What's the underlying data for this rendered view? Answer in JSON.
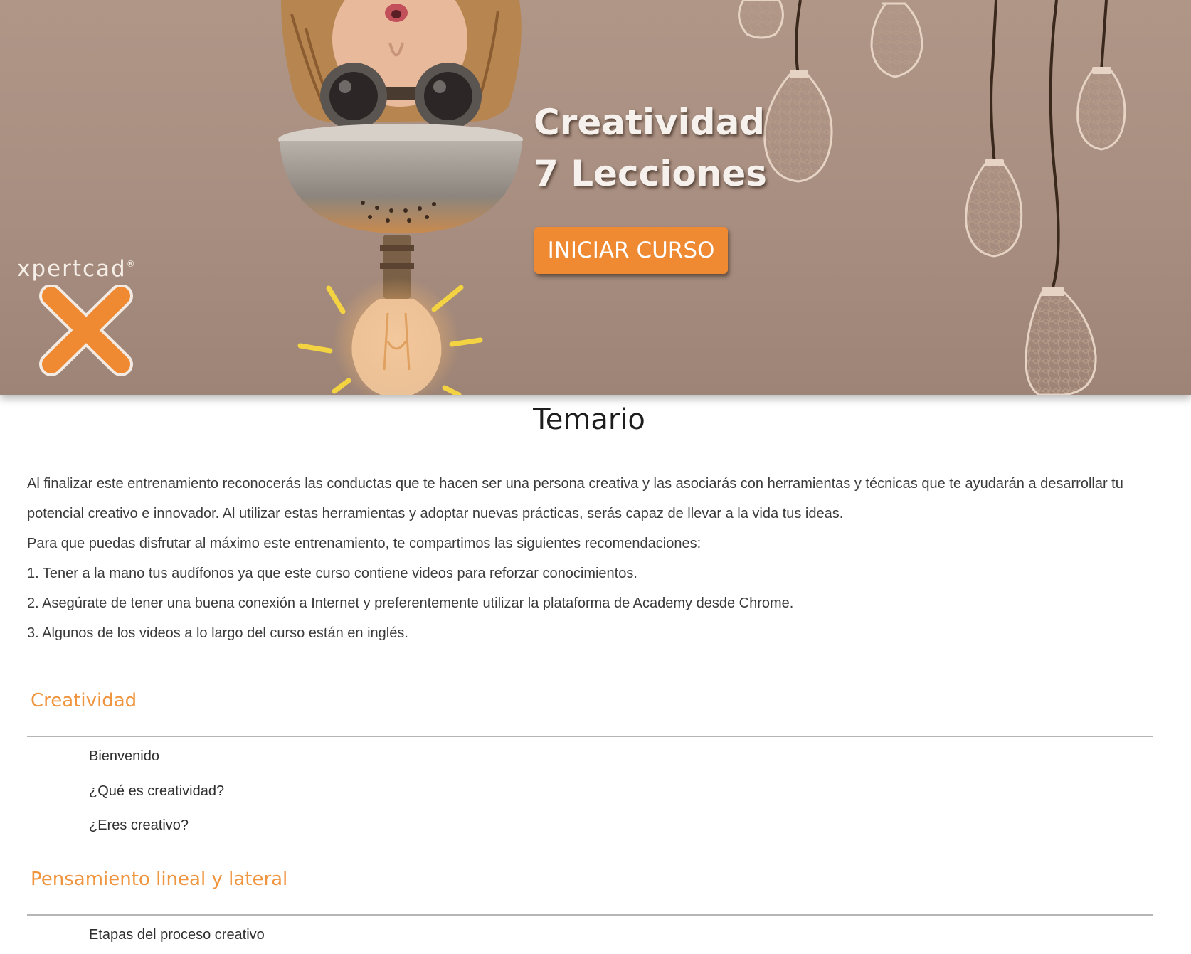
{
  "hero": {
    "title_line1": "Creatividad",
    "title_line2": "7 Lecciones",
    "start_button": "INICIAR CURSO",
    "brand_name": "xpertcad",
    "brand_mark": "®",
    "accent_color": "#ef8a33"
  },
  "syllabus": {
    "heading": "Temario",
    "intro": [
      "Al finalizar este entrenamiento reconocerás las conductas que te hacen ser una persona creativa y las asociarás con herramientas y técnicas que te ayudarán a desarrollar tu potencial creativo e innovador. Al utilizar estas herramientas y adoptar nuevas prácticas, serás capaz de llevar a la vida tus ideas.",
      "Para que puedas disfrutar al máximo este entrenamiento, te compartimos las siguientes recomendaciones:",
      "1. Tener a la mano tus audífonos ya que este curso contiene videos para reforzar conocimientos.",
      "2. Asegúrate de tener una buena conexión a Internet y preferentemente utilizar la plataforma de Academy desde Chrome.",
      "3. Algunos de los videos a lo largo del curso están en inglés."
    ],
    "modules": [
      {
        "title": "Creatividad",
        "lessons": [
          "Bienvenido",
          "¿Qué es creatividad?",
          "¿Eres creativo?"
        ]
      },
      {
        "title": "Pensamiento lineal y lateral",
        "lessons": [
          "Etapas del proceso creativo"
        ]
      }
    ]
  }
}
